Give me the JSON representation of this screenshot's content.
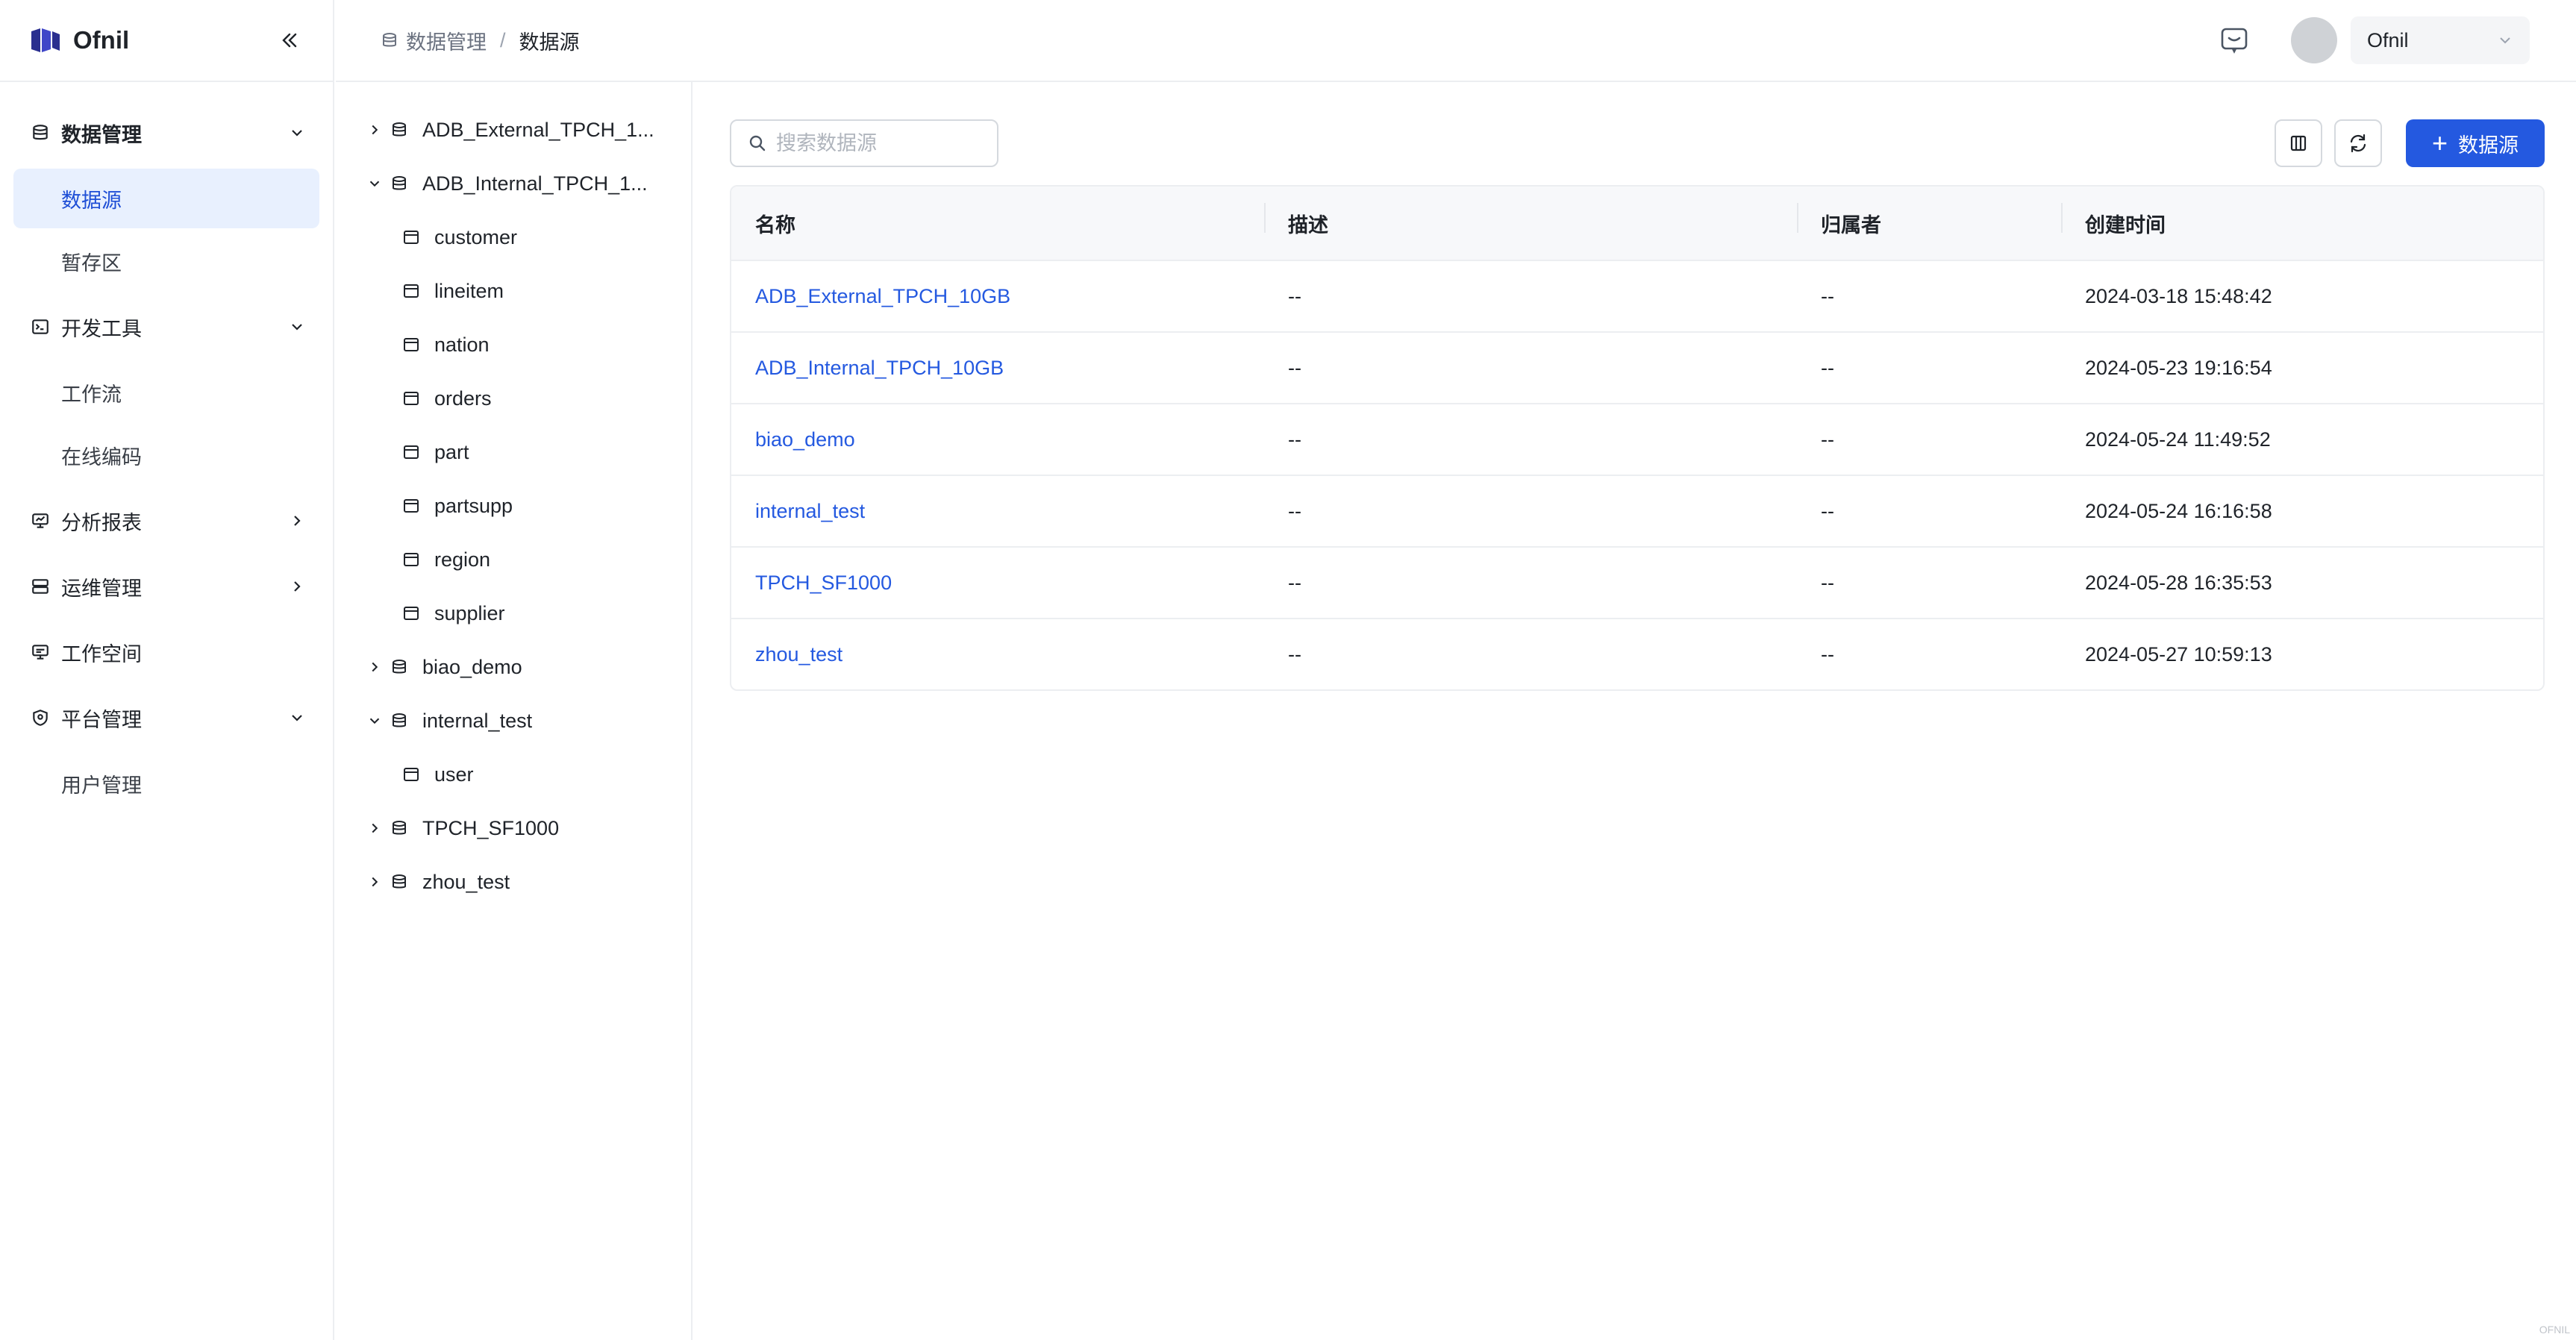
{
  "app": {
    "name": "Ofnil",
    "corner_mark": "OFNIL"
  },
  "sidebar": {
    "groups": [
      {
        "label": "数据管理",
        "icon": "database-icon",
        "bold": true,
        "expanded": true,
        "items": [
          {
            "label": "数据源",
            "active": true
          },
          {
            "label": "暂存区",
            "active": false
          }
        ]
      },
      {
        "label": "开发工具",
        "icon": "terminal-icon",
        "bold": false,
        "expanded": true,
        "items": [
          {
            "label": "工作流",
            "active": false
          },
          {
            "label": "在线编码",
            "active": false
          }
        ]
      },
      {
        "label": "分析报表",
        "icon": "chart-board-icon",
        "bold": false,
        "expanded": false,
        "items": []
      },
      {
        "label": "运维管理",
        "icon": "server-icon",
        "bold": false,
        "expanded": false,
        "items": []
      },
      {
        "label": "工作空间",
        "icon": "monitor-icon",
        "bold": false,
        "expanded": null,
        "items": []
      },
      {
        "label": "平台管理",
        "icon": "shield-icon",
        "bold": false,
        "expanded": true,
        "items": [
          {
            "label": "用户管理",
            "active": false
          }
        ]
      }
    ]
  },
  "header": {
    "breadcrumb": {
      "parent": "数据管理",
      "current": "数据源"
    },
    "user": "Ofnil"
  },
  "tree": {
    "nodes": [
      {
        "label": "ADB_External_TPCH_1...",
        "level": 0,
        "type": "db",
        "expanded": false
      },
      {
        "label": "ADB_Internal_TPCH_1...",
        "level": 0,
        "type": "db",
        "expanded": true
      },
      {
        "label": "customer",
        "level": 1,
        "type": "table"
      },
      {
        "label": "lineitem",
        "level": 1,
        "type": "table"
      },
      {
        "label": "nation",
        "level": 1,
        "type": "table"
      },
      {
        "label": "orders",
        "level": 1,
        "type": "table"
      },
      {
        "label": "part",
        "level": 1,
        "type": "table"
      },
      {
        "label": "partsupp",
        "level": 1,
        "type": "table"
      },
      {
        "label": "region",
        "level": 1,
        "type": "table"
      },
      {
        "label": "supplier",
        "level": 1,
        "type": "table"
      },
      {
        "label": "biao_demo",
        "level": 0,
        "type": "db",
        "expanded": false
      },
      {
        "label": "internal_test",
        "level": 0,
        "type": "db",
        "expanded": true
      },
      {
        "label": "user",
        "level": 1,
        "type": "table"
      },
      {
        "label": "TPCH_SF1000",
        "level": 0,
        "type": "db",
        "expanded": false
      },
      {
        "label": "zhou_test",
        "level": 0,
        "type": "db",
        "expanded": false
      }
    ]
  },
  "main": {
    "search_placeholder": "搜索数据源",
    "add_button": "数据源",
    "columns": [
      "名称",
      "描述",
      "归属者",
      "创建时间"
    ],
    "rows": [
      {
        "name": "ADB_External_TPCH_10GB",
        "desc": "--",
        "owner": "--",
        "created": "2024-03-18 15:48:42"
      },
      {
        "name": "ADB_Internal_TPCH_10GB",
        "desc": "--",
        "owner": "--",
        "created": "2024-05-23 19:16:54"
      },
      {
        "name": "biao_demo",
        "desc": "--",
        "owner": "--",
        "created": "2024-05-24 11:49:52"
      },
      {
        "name": "internal_test",
        "desc": "--",
        "owner": "--",
        "created": "2024-05-24 16:16:58"
      },
      {
        "name": "TPCH_SF1000",
        "desc": "--",
        "owner": "--",
        "created": "2024-05-28 16:35:53"
      },
      {
        "name": "zhou_test",
        "desc": "--",
        "owner": "--",
        "created": "2024-05-27 10:59:13"
      }
    ]
  },
  "colors": {
    "accent": "#2459e0",
    "active_bg": "#e8f0fe",
    "border": "#eceef1"
  }
}
